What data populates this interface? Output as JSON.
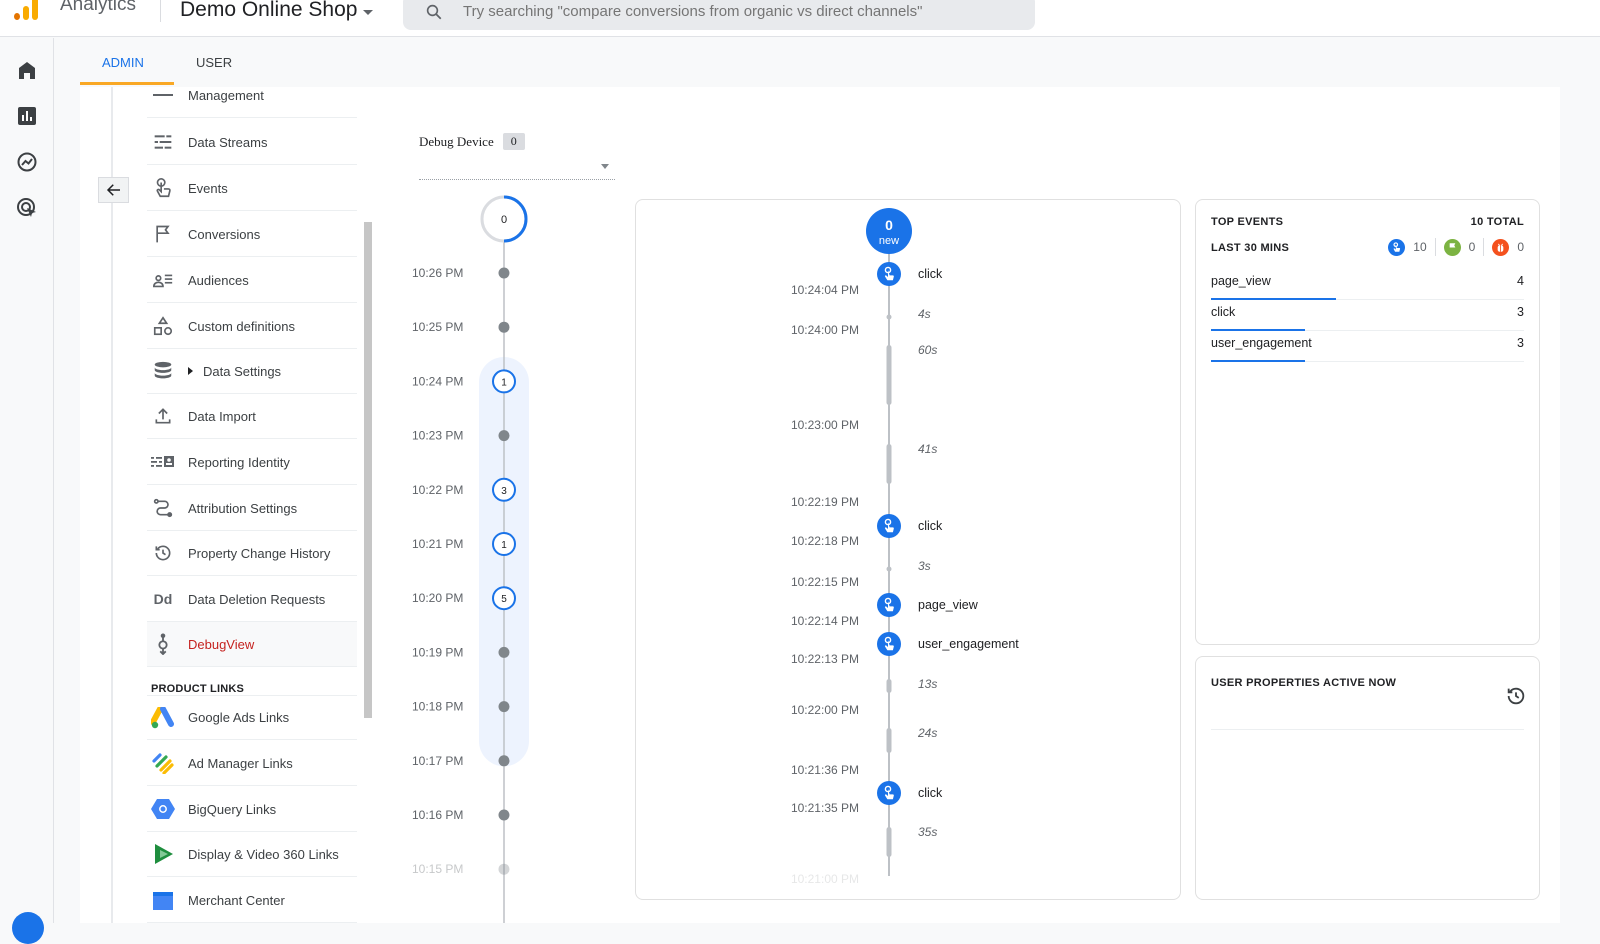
{
  "app": {
    "name": "Analytics",
    "property": "Demo Online Shop",
    "search_placeholder": "Try searching \"compare conversions from organic vs direct channels\""
  },
  "left_nav": [
    {
      "name": "home-icon"
    },
    {
      "name": "reports-icon"
    },
    {
      "name": "explore-icon"
    },
    {
      "name": "advertising-icon"
    }
  ],
  "tabs": [
    {
      "label": "ADMIN",
      "active": true
    },
    {
      "label": "USER",
      "active": false
    }
  ],
  "menu": {
    "items": [
      {
        "label": "Management",
        "icon": "dash-icon"
      },
      {
        "label": "Data Streams",
        "icon": "data-streams-icon"
      },
      {
        "label": "Events",
        "icon": "touch-icon"
      },
      {
        "label": "Conversions",
        "icon": "flag-icon"
      },
      {
        "label": "Audiences",
        "icon": "audiences-icon"
      },
      {
        "label": "Custom definitions",
        "icon": "shapes-icon"
      },
      {
        "label": "Data Settings",
        "icon": "database-icon",
        "expandable": true
      },
      {
        "label": "Data Import",
        "icon": "upload-icon"
      },
      {
        "label": "Reporting Identity",
        "icon": "identity-icon"
      },
      {
        "label": "Attribution Settings",
        "icon": "attribution-icon"
      },
      {
        "label": "Property Change History",
        "icon": "history-icon"
      },
      {
        "label": "Data Deletion Requests",
        "icon": "dd-icon"
      },
      {
        "label": "DebugView",
        "icon": "debug-icon",
        "active": true
      }
    ],
    "product_links_header": "PRODUCT LINKS",
    "product_links": [
      {
        "label": "Google Ads Links",
        "icon": "google-ads-icon"
      },
      {
        "label": "Ad Manager Links",
        "icon": "ad-manager-icon"
      },
      {
        "label": "BigQuery Links",
        "icon": "bigquery-icon"
      },
      {
        "label": "Display & Video 360 Links",
        "icon": "dv360-icon"
      },
      {
        "label": "Merchant Center",
        "icon": "merchant-center-icon"
      }
    ]
  },
  "debug_device": {
    "label": "Debug Device",
    "count": "0"
  },
  "minutes": {
    "top_count": "0",
    "rows": [
      {
        "time": "10:26 PM",
        "count": null
      },
      {
        "time": "10:25 PM",
        "count": null
      },
      {
        "time": "10:24 PM",
        "count": "1"
      },
      {
        "time": "10:23 PM",
        "count": null
      },
      {
        "time": "10:22 PM",
        "count": "3"
      },
      {
        "time": "10:21 PM",
        "count": "1"
      },
      {
        "time": "10:20 PM",
        "count": "5"
      },
      {
        "time": "10:19 PM",
        "count": null
      },
      {
        "time": "10:18 PM",
        "count": null
      },
      {
        "time": "10:17 PM",
        "count": null
      },
      {
        "time": "10:16 PM",
        "count": null
      },
      {
        "time": "10:15 PM",
        "count": null
      }
    ]
  },
  "seconds": {
    "new_count": "0",
    "new_label": "new",
    "timestamps": [
      {
        "time": "10:24:04 PM"
      },
      {
        "time": "10:24:00 PM"
      },
      {
        "time": "10:23:00 PM"
      },
      {
        "time": "10:22:19 PM"
      },
      {
        "time": "10:22:18 PM"
      },
      {
        "time": "10:22:15 PM"
      },
      {
        "time": "10:22:14 PM"
      },
      {
        "time": "10:22:13 PM"
      },
      {
        "time": "10:22:00 PM"
      },
      {
        "time": "10:21:36 PM"
      },
      {
        "time": "10:21:35 PM"
      },
      {
        "time": "10:21:00 PM"
      }
    ],
    "events": [
      {
        "name": "click"
      },
      {
        "name": "click"
      },
      {
        "name": "page_view"
      },
      {
        "name": "user_engagement"
      },
      {
        "name": "click"
      }
    ],
    "gaps": [
      "4s",
      "60s",
      "41s",
      "3s",
      "13s",
      "24s",
      "35s"
    ]
  },
  "top_events": {
    "title": "TOP EVENTS",
    "total": "10 TOTAL",
    "subtitle": "LAST 30 MINS",
    "stats": [
      {
        "icon": "event-icon",
        "value": "10",
        "color": "#1a73e8"
      },
      {
        "icon": "conversion-icon",
        "value": "0",
        "color": "#7cb342"
      },
      {
        "icon": "error-icon",
        "value": "0",
        "color": "#f4511e"
      }
    ],
    "rows": [
      {
        "name": "page_view",
        "count": "4",
        "share": 0.4
      },
      {
        "name": "click",
        "count": "3",
        "share": 0.3
      },
      {
        "name": "user_engagement",
        "count": "3",
        "share": 0.3
      }
    ]
  },
  "user_properties": {
    "title": "USER PROPERTIES ACTIVE NOW"
  },
  "colors": {
    "accent": "#1a73e8",
    "tab_indicator": "#f9a825",
    "active_menu": "#c5221f"
  }
}
